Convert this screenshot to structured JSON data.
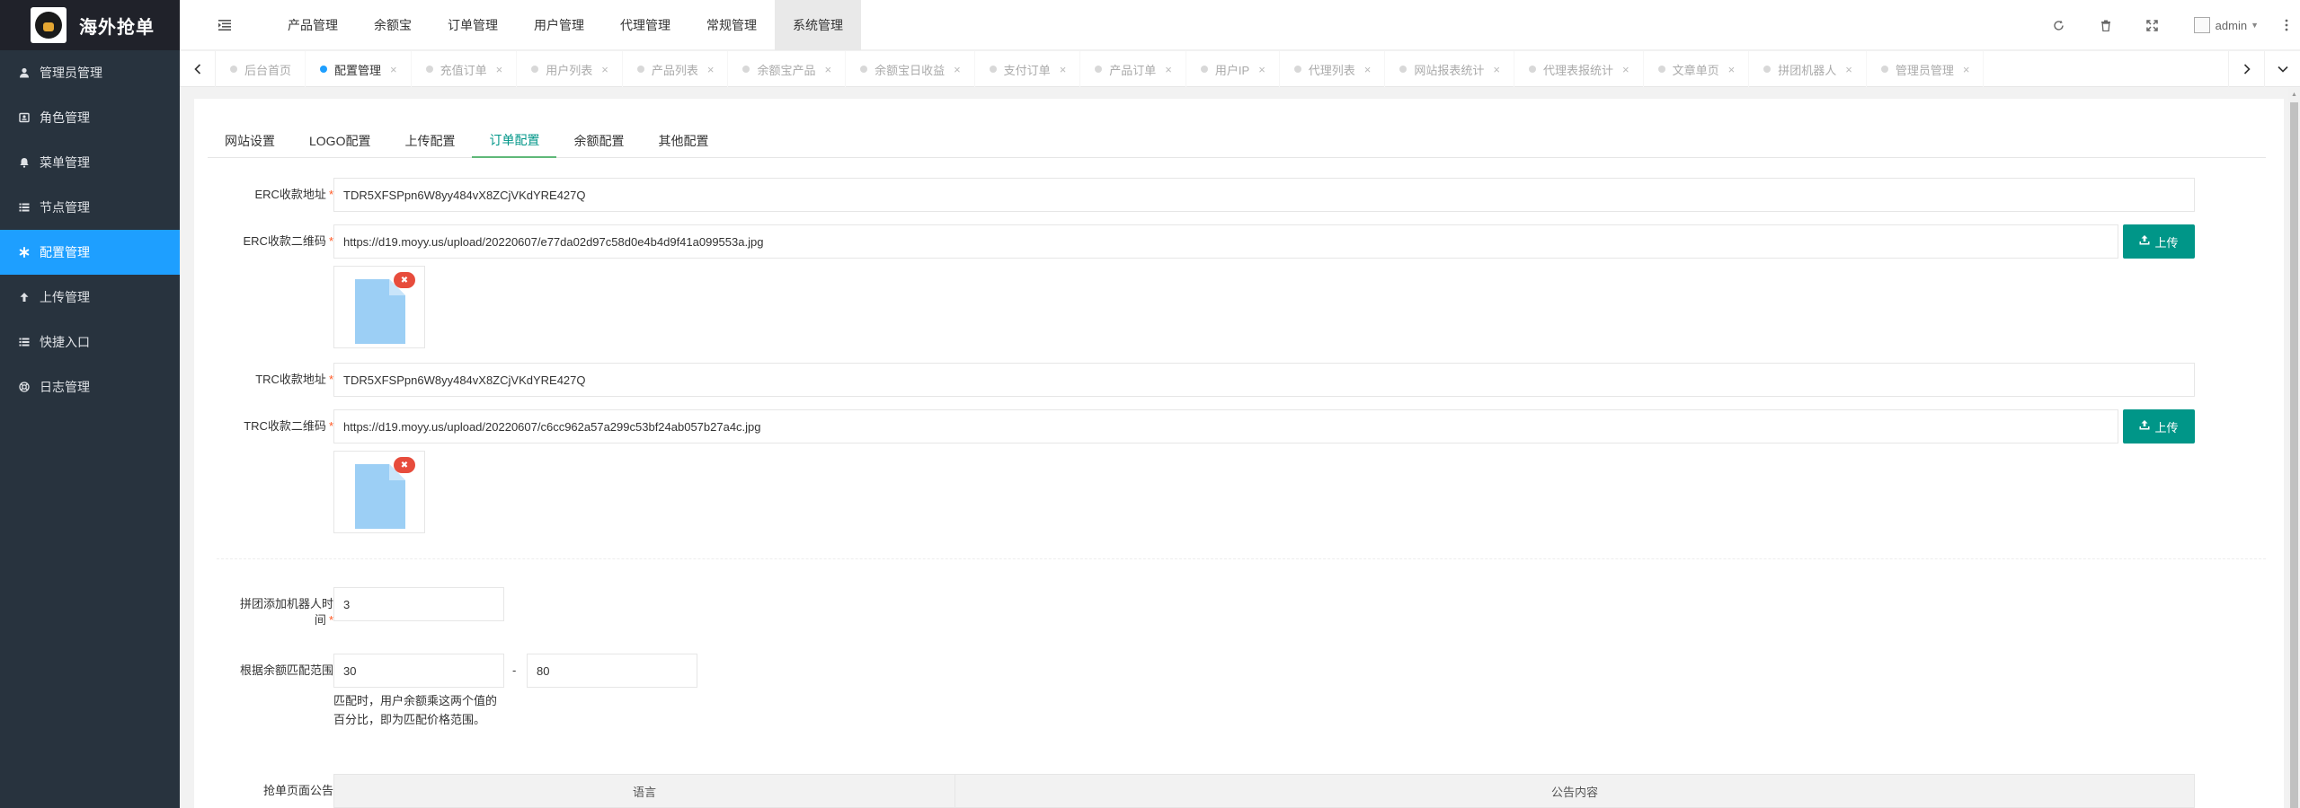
{
  "app": {
    "title": "海外抢单"
  },
  "sidebar": {
    "items": [
      {
        "label": "管理员管理",
        "icon": "user-icon",
        "active": false
      },
      {
        "label": "角色管理",
        "icon": "id-card-icon",
        "active": false
      },
      {
        "label": "菜单管理",
        "icon": "bell-icon",
        "active": false
      },
      {
        "label": "节点管理",
        "icon": "list-icon",
        "active": false
      },
      {
        "label": "配置管理",
        "icon": "asterisk-icon",
        "active": true
      },
      {
        "label": "上传管理",
        "icon": "arrow-up-icon",
        "active": false
      },
      {
        "label": "快捷入口",
        "icon": "list-icon",
        "active": false
      },
      {
        "label": "日志管理",
        "icon": "life-ring-icon",
        "active": false
      }
    ]
  },
  "header": {
    "nav": [
      "产品管理",
      "余额宝",
      "订单管理",
      "用户管理",
      "代理管理",
      "常规管理",
      "系统管理"
    ],
    "active_nav": "系统管理",
    "user": "admin"
  },
  "tabs": [
    {
      "label": "后台首页",
      "closable": false,
      "active": false
    },
    {
      "label": "配置管理",
      "closable": true,
      "active": true
    },
    {
      "label": "充值订单",
      "closable": true,
      "active": false
    },
    {
      "label": "用户列表",
      "closable": true,
      "active": false
    },
    {
      "label": "产品列表",
      "closable": true,
      "active": false
    },
    {
      "label": "余额宝产品",
      "closable": true,
      "active": false
    },
    {
      "label": "余额宝日收益",
      "closable": true,
      "active": false
    },
    {
      "label": "支付订单",
      "closable": true,
      "active": false
    },
    {
      "label": "产品订单",
      "closable": true,
      "active": false
    },
    {
      "label": "用户IP",
      "closable": true,
      "active": false
    },
    {
      "label": "代理列表",
      "closable": true,
      "active": false
    },
    {
      "label": "网站报表统计",
      "closable": true,
      "active": false
    },
    {
      "label": "代理表报统计",
      "closable": true,
      "active": false
    },
    {
      "label": "文章单页",
      "closable": true,
      "active": false
    },
    {
      "label": "拼团机器人",
      "closable": true,
      "active": false
    },
    {
      "label": "管理员管理",
      "closable": true,
      "active": false
    }
  ],
  "form_tabs": [
    "网站设置",
    "LOGO配置",
    "上传配置",
    "订单配置",
    "余额配置",
    "其他配置"
  ],
  "active_form_tab": "订单配置",
  "form": {
    "erc_address": {
      "label": "ERC收款地址",
      "value": "TDR5XFSPpn6W8yy484vX8ZCjVKdYRE427Q"
    },
    "erc_qr": {
      "label": "ERC收款二维码",
      "value": "https://d19.moyy.us/upload/20220607/e77da02d97c58d0e4b4d9f41a099553a.jpg",
      "upload_label": "上传"
    },
    "trc_address": {
      "label": "TRC收款地址",
      "value": "TDR5XFSPpn6W8yy484vX8ZCjVKdYRE427Q"
    },
    "trc_qr": {
      "label": "TRC收款二维码",
      "value": "https://d19.moyy.us/upload/20220607/c6cc962a57a299c53bf24ab057b27a4c.jpg",
      "upload_label": "上传"
    },
    "robot_time": {
      "label": "拼团添加机器人时间",
      "value": "3"
    },
    "match_range": {
      "label": "根据余额匹配范围",
      "min": "30",
      "separator": "-",
      "max": "80",
      "help": "匹配时，用户余额乘这两个值的百分比，即为匹配价格范围。"
    },
    "announcement": {
      "label": "抢单页面公告",
      "columns": [
        "语言",
        "公告内容"
      ]
    }
  },
  "colors": {
    "sidebar_bg": "#28333e",
    "sidebar_active": "#1e9fff",
    "primary_button": "#009688",
    "tab_active": "#009688",
    "required": "#ff5722",
    "delete_badge": "#e74c3c"
  }
}
